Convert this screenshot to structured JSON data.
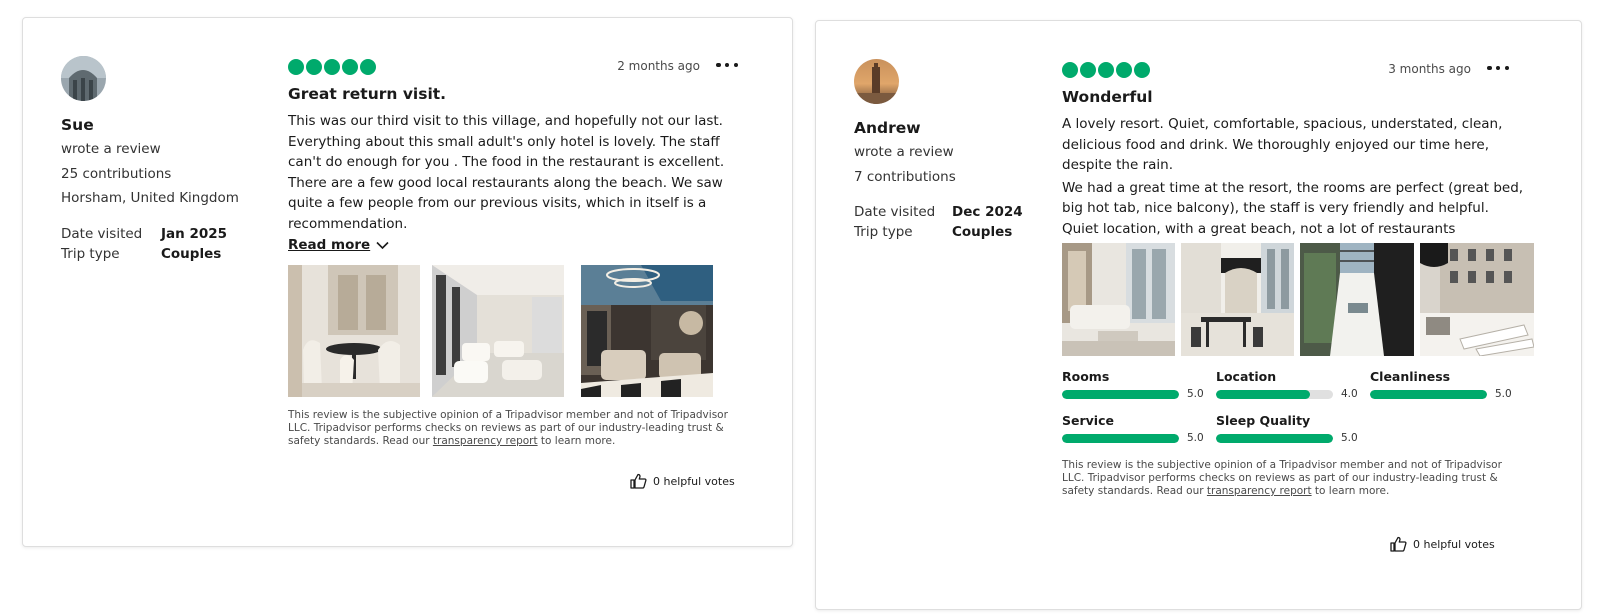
{
  "reviews": [
    {
      "user": {
        "name": "Sue",
        "action": "wrote a review",
        "contributions": "25 contributions",
        "location": "Horsham, United Kingdom"
      },
      "date_visited_label": "Date visited",
      "date_visited": "Jan 2025",
      "trip_type_label": "Trip type",
      "trip_type": "Couples",
      "rating": 5,
      "posted": "2 months ago",
      "title": "Great return visit.",
      "body": [
        "This was our third visit to  this village, and hopefully not our last. Everything about this small adult's only hotel is lovely. The staff can't do enough for you . The food in the restaurant is excellent.  There are a few good local restaurants along the beach. We saw quite a few people from our previous visits, which in itself is a recommendation."
      ],
      "read_more": "Read more",
      "disclaimer_1": "This review is the subjective opinion of a Tripadvisor member and not of Tripadvisor LLC. Tripadvisor performs checks on reviews as part of our industry-leading trust & safety standards. Read our ",
      "disclaimer_link": "transparency report",
      "disclaimer_2": " to learn more.",
      "helpful": "0 helpful votes"
    },
    {
      "user": {
        "name": "Andrew",
        "action": "wrote a review",
        "contributions": "7 contributions"
      },
      "date_visited_label": "Date visited",
      "date_visited": "Dec 2024",
      "trip_type_label": "Trip type",
      "trip_type": "Couples",
      "rating": 5,
      "posted": "3 months ago",
      "title": "Wonderful",
      "body": [
        "A lovely resort.  Quiet, comfortable, spacious, understated, clean, delicious food and drink.  We thoroughly enjoyed our time here, despite the rain.",
        "We had a great time at the resort, the rooms are perfect (great bed, big hot tab, nice balcony), the staff is very friendly and helpful. Quiet location, with a great beach, not a lot of restaurants"
      ],
      "subratings": [
        {
          "name": "Rooms",
          "value": "5.0",
          "fraction": 1.0
        },
        {
          "name": "Location",
          "value": "4.0",
          "fraction": 0.8
        },
        {
          "name": "Cleanliness",
          "value": "5.0",
          "fraction": 1.0
        },
        {
          "name": "Service",
          "value": "5.0",
          "fraction": 1.0
        },
        {
          "name": "Sleep Quality",
          "value": "5.0",
          "fraction": 1.0
        }
      ],
      "disclaimer_1": "This review is the subjective opinion of a Tripadvisor member and not of Tripadvisor LLC. Tripadvisor performs checks on reviews as part of our industry-leading trust & safety standards. Read our ",
      "disclaimer_link": "transparency report",
      "disclaimer_2": " to learn more.",
      "helpful": "0 helpful votes"
    }
  ],
  "colors": {
    "accent": "#00aa6c",
    "text": "#1a1a1a",
    "muted": "#4a4a4a",
    "track": "#e0e0e0"
  },
  "icons": [
    "more-options-icon",
    "chevron-down-icon",
    "thumbs-up-icon"
  ]
}
